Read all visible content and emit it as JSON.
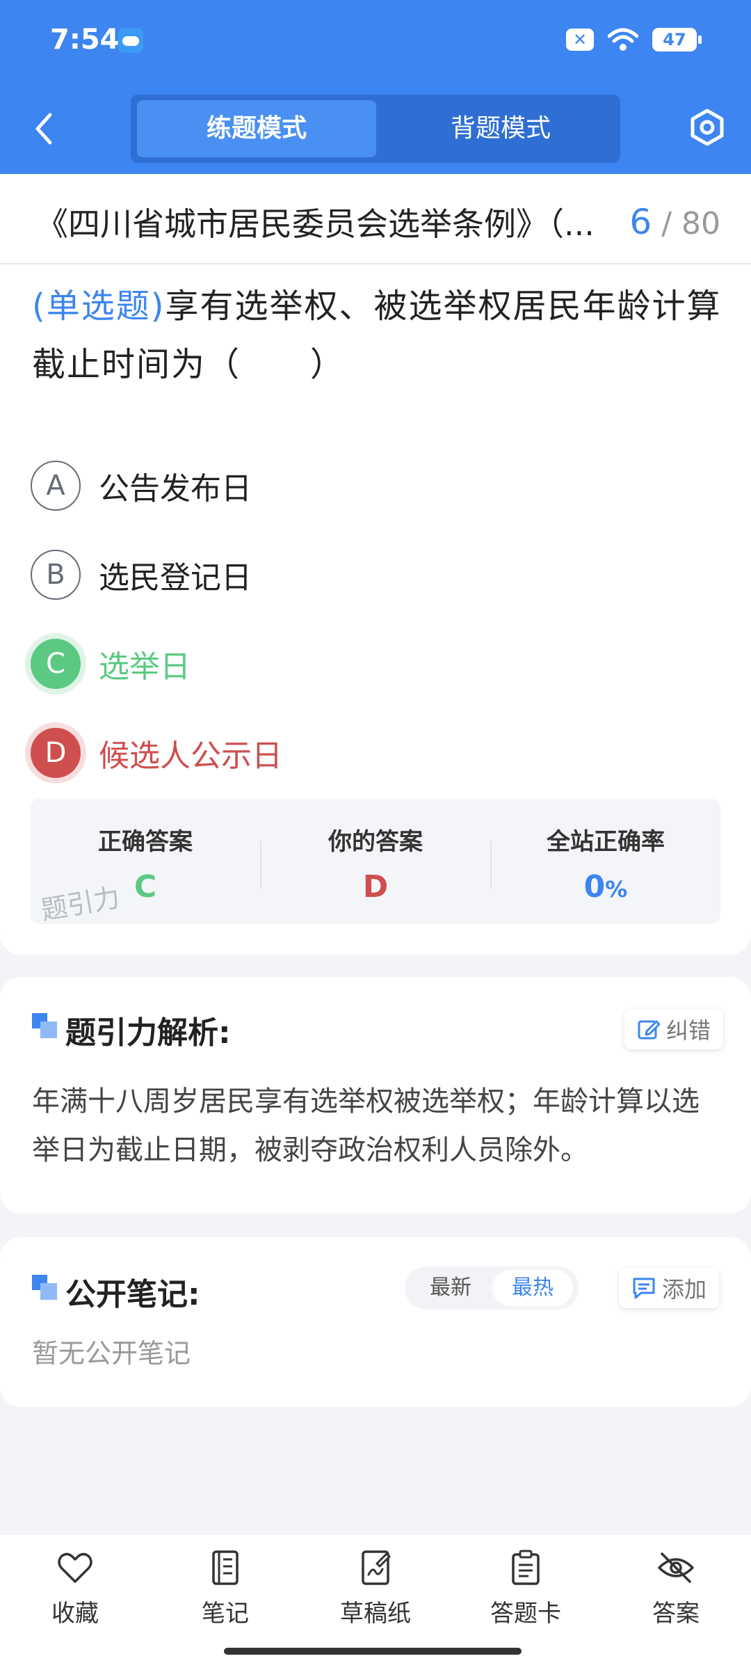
{
  "status_bar": {
    "time": "7:54",
    "battery": "47"
  },
  "header": {
    "tabs": [
      {
        "label": "练题模式",
        "active": true
      },
      {
        "label": "背题模式",
        "active": false
      }
    ]
  },
  "question_header": {
    "title": "《四川省城市居民委员会选举条例》（...",
    "current": "6",
    "total": "/ 80"
  },
  "question": {
    "type": "(单选题)",
    "text": "享有选举权、被选举权居民年龄计算截止时间为（　　）",
    "options": [
      {
        "letter": "A",
        "text": "公告发布日",
        "state": "normal"
      },
      {
        "letter": "B",
        "text": "选民登记日",
        "state": "normal"
      },
      {
        "letter": "C",
        "text": "选举日",
        "state": "correct"
      },
      {
        "letter": "D",
        "text": "候选人公示日",
        "state": "wrong"
      }
    ]
  },
  "answers": {
    "correct_label": "正确答案",
    "correct_value": "C",
    "yours_label": "你的答案",
    "yours_value": "D",
    "rate_label": "全站正确率",
    "rate_value": "0",
    "rate_unit": "%",
    "watermark": "题引力"
  },
  "analysis": {
    "title": "题引力解析:",
    "report_label": "纠错",
    "text": "年满十八周岁居民享有选举权被选举权；年龄计算以选举日为截止日期，被剥夺政治权利人员除外。"
  },
  "notes": {
    "title": "公开笔记:",
    "sort_latest": "最新",
    "sort_hot": "最热",
    "add_label": "添加",
    "empty_text": "暂无公开笔记"
  },
  "bottom_nav": [
    {
      "label": "收藏",
      "icon": "heart-icon"
    },
    {
      "label": "笔记",
      "icon": "notebook-icon"
    },
    {
      "label": "草稿纸",
      "icon": "draft-icon"
    },
    {
      "label": "答题卡",
      "icon": "answer-sheet-icon"
    },
    {
      "label": "答案",
      "icon": "eye-off-icon"
    }
  ],
  "colors": {
    "primary": "#3d85f0",
    "correct": "#5bc982",
    "wrong": "#cf4e4e"
  }
}
